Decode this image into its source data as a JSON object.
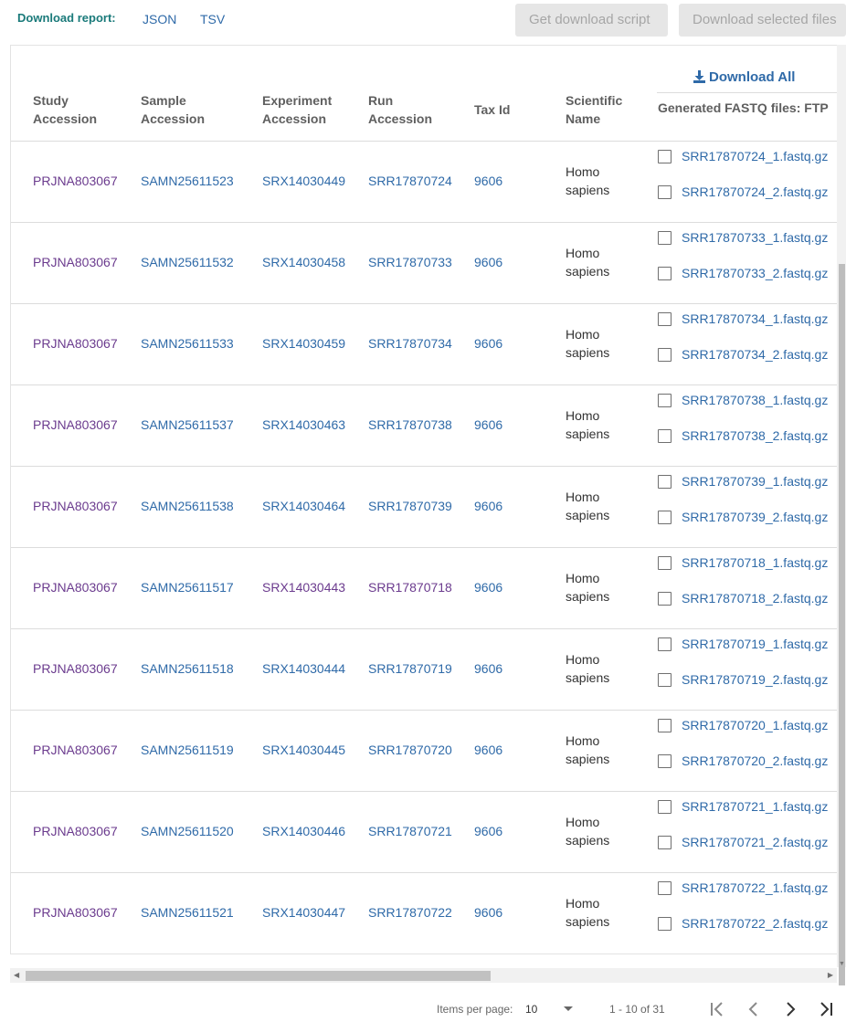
{
  "download_report": {
    "label": "Download report:",
    "json": "JSON",
    "tsv": "TSV"
  },
  "buttons": {
    "get_script": "Get download script",
    "download_selected": "Download selected files"
  },
  "table": {
    "headers": {
      "study": [
        "Study",
        "Accession"
      ],
      "sample": [
        "Sample",
        "Accession"
      ],
      "experiment": [
        "Experiment",
        "Accession"
      ],
      "run": [
        "Run",
        "Accession"
      ],
      "tax": "Tax Id",
      "scientific": [
        "Scientific",
        "Name"
      ],
      "download_all": "Download All",
      "ftp": "Generated FASTQ files: FTP"
    },
    "rows": [
      {
        "study": "PRJNA803067",
        "sample": "SAMN25611523",
        "experiment": "SRX14030449",
        "run": "SRR17870724",
        "tax": "9606",
        "name": [
          "Homo",
          "sapiens"
        ],
        "files": [
          "SRR17870724_1.fastq.gz",
          "SRR17870724_2.fastq.gz"
        ],
        "visited": {
          "experiment": false,
          "run": false
        }
      },
      {
        "study": "PRJNA803067",
        "sample": "SAMN25611532",
        "experiment": "SRX14030458",
        "run": "SRR17870733",
        "tax": "9606",
        "name": [
          "Homo",
          "sapiens"
        ],
        "files": [
          "SRR17870733_1.fastq.gz",
          "SRR17870733_2.fastq.gz"
        ],
        "visited": {
          "experiment": false,
          "run": false
        }
      },
      {
        "study": "PRJNA803067",
        "sample": "SAMN25611533",
        "experiment": "SRX14030459",
        "run": "SRR17870734",
        "tax": "9606",
        "name": [
          "Homo",
          "sapiens"
        ],
        "files": [
          "SRR17870734_1.fastq.gz",
          "SRR17870734_2.fastq.gz"
        ],
        "visited": {
          "experiment": false,
          "run": false
        }
      },
      {
        "study": "PRJNA803067",
        "sample": "SAMN25611537",
        "experiment": "SRX14030463",
        "run": "SRR17870738",
        "tax": "9606",
        "name": [
          "Homo",
          "sapiens"
        ],
        "files": [
          "SRR17870738_1.fastq.gz",
          "SRR17870738_2.fastq.gz"
        ],
        "visited": {
          "experiment": false,
          "run": false
        }
      },
      {
        "study": "PRJNA803067",
        "sample": "SAMN25611538",
        "experiment": "SRX14030464",
        "run": "SRR17870739",
        "tax": "9606",
        "name": [
          "Homo",
          "sapiens"
        ],
        "files": [
          "SRR17870739_1.fastq.gz",
          "SRR17870739_2.fastq.gz"
        ],
        "visited": {
          "experiment": false,
          "run": false
        }
      },
      {
        "study": "PRJNA803067",
        "sample": "SAMN25611517",
        "experiment": "SRX14030443",
        "run": "SRR17870718",
        "tax": "9606",
        "name": [
          "Homo",
          "sapiens"
        ],
        "files": [
          "SRR17870718_1.fastq.gz",
          "SRR17870718_2.fastq.gz"
        ],
        "visited": {
          "experiment": true,
          "run": true
        }
      },
      {
        "study": "PRJNA803067",
        "sample": "SAMN25611518",
        "experiment": "SRX14030444",
        "run": "SRR17870719",
        "tax": "9606",
        "name": [
          "Homo",
          "sapiens"
        ],
        "files": [
          "SRR17870719_1.fastq.gz",
          "SRR17870719_2.fastq.gz"
        ],
        "visited": {
          "experiment": false,
          "run": false
        }
      },
      {
        "study": "PRJNA803067",
        "sample": "SAMN25611519",
        "experiment": "SRX14030445",
        "run": "SRR17870720",
        "tax": "9606",
        "name": [
          "Homo",
          "sapiens"
        ],
        "files": [
          "SRR17870720_1.fastq.gz",
          "SRR17870720_2.fastq.gz"
        ],
        "visited": {
          "experiment": false,
          "run": false
        }
      },
      {
        "study": "PRJNA803067",
        "sample": "SAMN25611520",
        "experiment": "SRX14030446",
        "run": "SRR17870721",
        "tax": "9606",
        "name": [
          "Homo",
          "sapiens"
        ],
        "files": [
          "SRR17870721_1.fastq.gz",
          "SRR17870721_2.fastq.gz"
        ],
        "visited": {
          "experiment": false,
          "run": false
        }
      },
      {
        "study": "PRJNA803067",
        "sample": "SAMN25611521",
        "experiment": "SRX14030447",
        "run": "SRR17870722",
        "tax": "9606",
        "name": [
          "Homo",
          "sapiens"
        ],
        "files": [
          "SRR17870722_1.fastq.gz",
          "SRR17870722_2.fastq.gz"
        ],
        "visited": {
          "experiment": false,
          "run": false
        }
      }
    ]
  },
  "paginator": {
    "items_per_page_label": "Items per page:",
    "items_per_page": "10",
    "range": "1 - 10 of 31"
  },
  "colors": {
    "link": "#2f6aa8",
    "visited": "#6b3b8e",
    "teal_label": "#1a7a7a",
    "disabled_bg": "#e6e6e6"
  }
}
